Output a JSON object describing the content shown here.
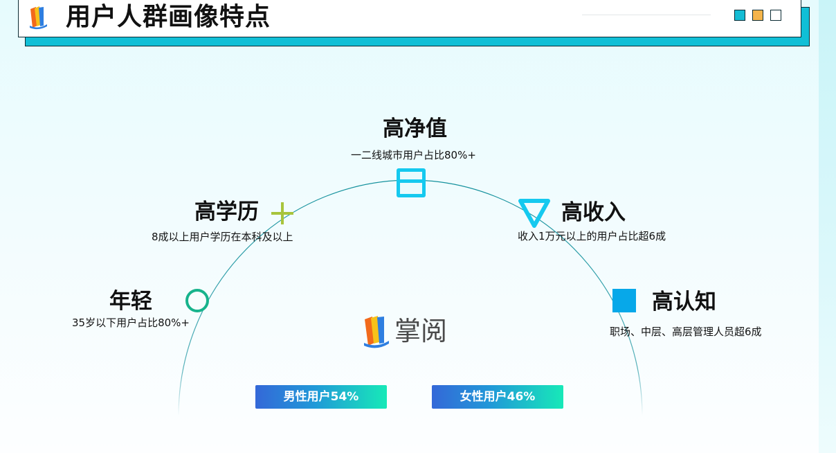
{
  "header": {
    "title": "用户人群画像特点",
    "logo_icon": "zhangyue-book-logo",
    "decor_squares": [
      "#14bcd4",
      "#f5b44a",
      "#ffffff"
    ]
  },
  "features": [
    {
      "title": "高净值",
      "desc": "一二线城市用户占比80%+",
      "icon": "square-frame-icon",
      "color": "#15c9ef"
    },
    {
      "title": "高学历",
      "desc": "8成以上用户学历在本科及以上",
      "icon": "plus-icon",
      "color": "#a8c43c"
    },
    {
      "title": "高收入",
      "desc": "收入1万元以上的用户占比超6成",
      "icon": "triangle-down-icon",
      "color": "#15c9ef"
    },
    {
      "title": "年轻",
      "desc": "35岁以下用户占比80%+",
      "icon": "ring-icon",
      "color": "#17b38c"
    },
    {
      "title": "高认知",
      "desc": "职场、中层、高层管理人员超6成",
      "icon": "filled-square-icon",
      "color": "#07a8e9"
    }
  ],
  "brand": {
    "name": "掌阅",
    "icon": "zhangyue-book-logo"
  },
  "gender": {
    "male": "男性用户54%",
    "female": "女性用户46%"
  },
  "colors": {
    "accent": "#10bfd6",
    "arc": "#12909c",
    "pill_start": "#3468d8",
    "pill_end": "#17e9b8"
  }
}
